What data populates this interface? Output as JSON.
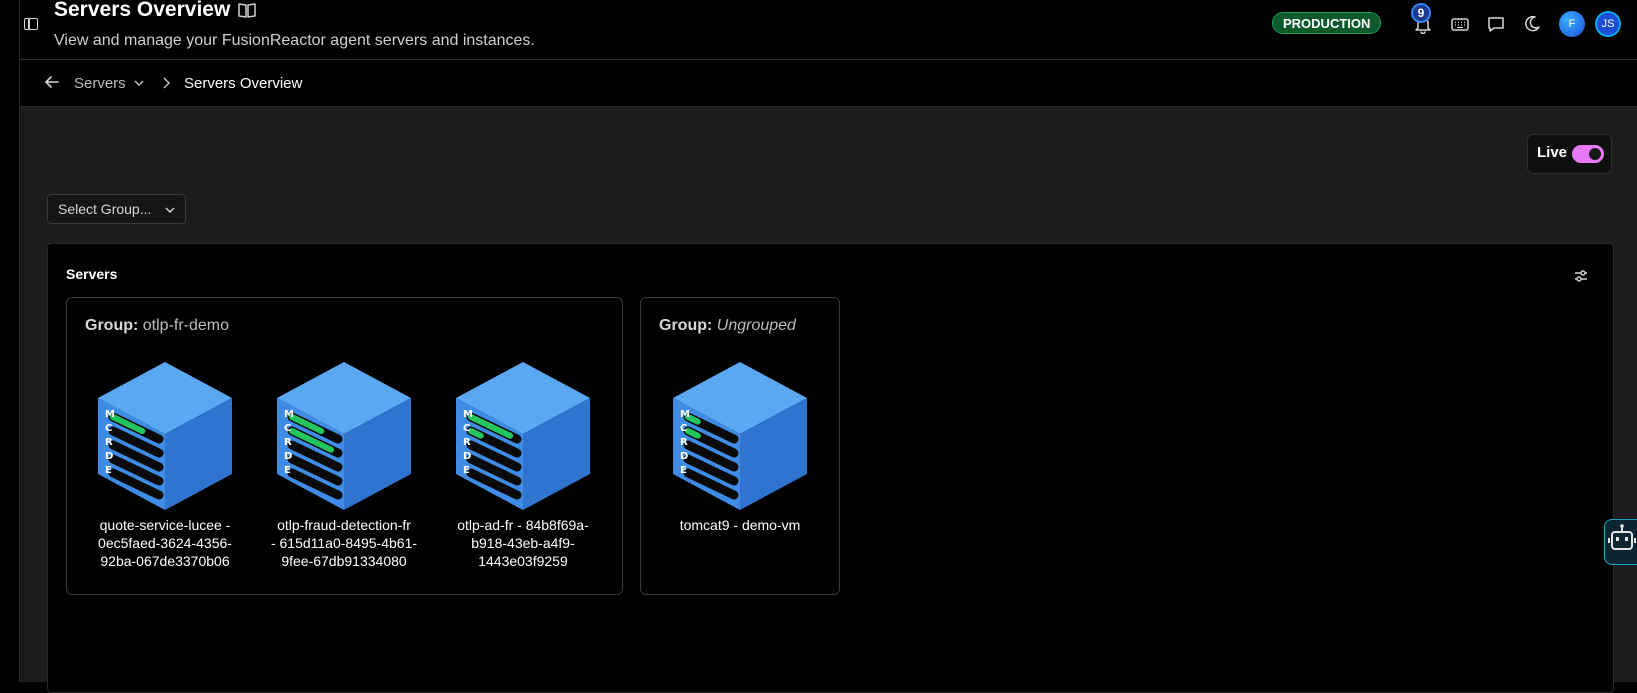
{
  "header": {
    "title": "Servers Overview",
    "subtitle": "View and manage your FusionReactor agent servers and instances.",
    "environment_badge": "PRODUCTION",
    "notification_count": "9",
    "avatar_f": "F",
    "avatar_js": "JS"
  },
  "breadcrumb": {
    "parent": "Servers",
    "current": "Servers Overview"
  },
  "live": {
    "label": "Live",
    "enabled": true
  },
  "group_select": {
    "placeholder": "Select Group..."
  },
  "servers_panel": {
    "title": "Servers",
    "groups": [
      {
        "label_prefix": "Group:",
        "name": "otlp-fr-demo",
        "servers": [
          {
            "line1": "quote-service-lucee -",
            "line2": "0ec5faed-3624-4356-",
            "line3": "92ba-067de3370b06",
            "side_letters": [
              "M",
              "C",
              "R",
              "D",
              "E"
            ]
          },
          {
            "line1": "otlp-fraud-detection-fr",
            "line2": "- 615d11a0-8495-4b61-",
            "line3": "9fee-67db91334080",
            "side_letters": [
              "M",
              "C",
              "R",
              "D",
              "E"
            ]
          },
          {
            "line1": "otlp-ad-fr - 84b8f69a-",
            "line2": "b918-43eb-a4f9-",
            "line3": "1443e03f9259",
            "side_letters": [
              "M",
              "C",
              "R",
              "D",
              "E"
            ]
          }
        ]
      },
      {
        "label_prefix": "Group:",
        "name": "Ungrouped",
        "servers": [
          {
            "line1": "tomcat9 - demo-vm",
            "side_letters": [
              "M",
              "C",
              "R",
              "D",
              "E"
            ]
          }
        ]
      }
    ]
  },
  "colors": {
    "cube_top": "#5aa7f2",
    "cube_front": "#3f8ce6",
    "cube_side": "#2f74cf",
    "meter_fill": "#22c55e",
    "live_toggle": "#e879f9",
    "badge_bg": "#0f5a2c"
  }
}
